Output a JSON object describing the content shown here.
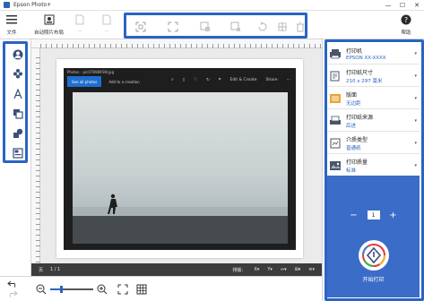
{
  "window": {
    "title": "Epson Photo+",
    "minimize": "—",
    "maximize": "☐",
    "close": "✕"
  },
  "toolbar": {
    "file_label": "文件",
    "auto_layout_label": "自动照片布局",
    "disabled_1_label": "—",
    "disabled_2_label": "—",
    "help_label": "帮助"
  },
  "canvas": {
    "photo_window_title": "Photos - pic0789895W.jpg",
    "see_all_photos": "See all photos",
    "add_to_creation": "Add to a creation",
    "edit_create": "Edit & Create",
    "share": "Share",
    "status": {
      "page_label": "页",
      "page_value": "1 / 1",
      "align_label": "排版："
    }
  },
  "settings": {
    "printer": {
      "title": "打印机",
      "value": "EPSON XX-XXXX"
    },
    "paper_size": {
      "title": "打印纸尺寸",
      "value": "210 x 297 毫米"
    },
    "layout": {
      "title": "版面",
      "value": "无边距"
    },
    "paper_source": {
      "title": "打印纸来源",
      "value": "后进"
    },
    "media_type": {
      "title": "介质类型",
      "value": "普通纸"
    },
    "quality": {
      "title": "打印质量",
      "value": "标准"
    }
  },
  "print": {
    "copies": "1",
    "minus": "−",
    "plus": "+",
    "button_label": "开始打印"
  },
  "zoom": {
    "level": 0.25
  },
  "colors": {
    "accent": "#2a64c4",
    "print_panel": "#3b6cc7",
    "status_bar": "#3c3c3c"
  }
}
